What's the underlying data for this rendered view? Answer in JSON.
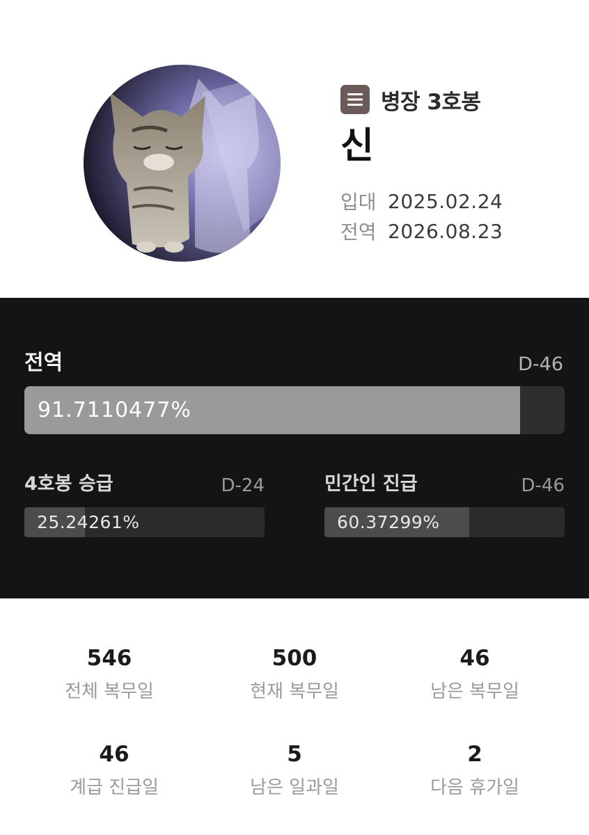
{
  "profile": {
    "rank": "병장 3호봉",
    "rank_icon": "list-icon",
    "name": "신",
    "enlist_label": "입대",
    "enlist_date": "2025.02.24",
    "discharge_label": "전역",
    "discharge_date": "2026.08.23"
  },
  "progress": {
    "main": {
      "title": "전역",
      "dday": "D-46",
      "percent_text": "91.7110477%",
      "fraction": 0.917110477
    },
    "items": [
      {
        "title": "4호봉 승급",
        "dday": "D-24",
        "percent_text": "25.24261%",
        "fraction": 0.2524261
      },
      {
        "title": "민간인 진급",
        "dday": "D-46",
        "percent_text": "60.37299%",
        "fraction": 0.6037299
      }
    ]
  },
  "stats": [
    {
      "value": "546",
      "label": "전체 복무일"
    },
    {
      "value": "500",
      "label": "현재 복무일"
    },
    {
      "value": "46",
      "label": "남은 복무일"
    },
    {
      "value": "46",
      "label": "계급 진급일"
    },
    {
      "value": "5",
      "label": "남은 일과일"
    },
    {
      "value": "2",
      "label": "다음 휴가일"
    }
  ],
  "colors": {
    "panel_bg": "#141414",
    "main_fill": "#9a9a9a",
    "sub_fill": "#4c4c4c",
    "rank_badge": "#6a5a58"
  }
}
